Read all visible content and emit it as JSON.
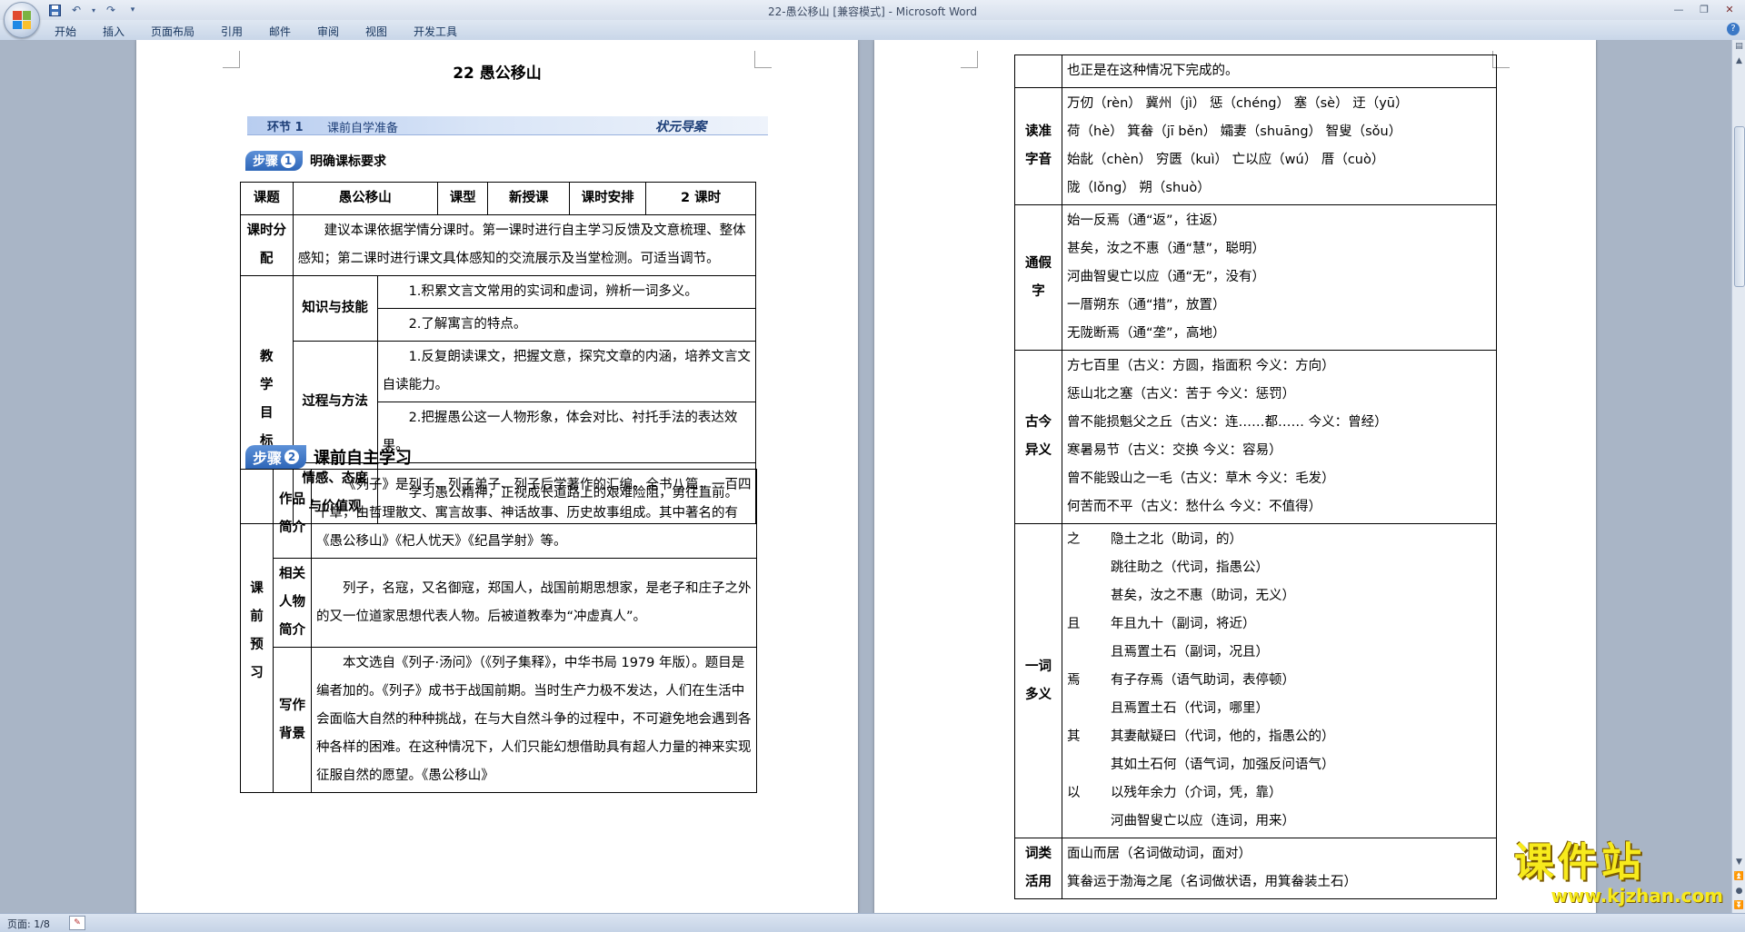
{
  "window": {
    "title": "22-愚公移山 [兼容模式] - Microsoft Word",
    "controls": [
      "minimize-icon",
      "restore-icon",
      "close-icon"
    ]
  },
  "ribbon": {
    "tabs": [
      "开始",
      "插入",
      "页面布局",
      "引用",
      "邮件",
      "审阅",
      "视图",
      "开发工具"
    ]
  },
  "status": {
    "page": "页面: 1/8"
  },
  "watermark": {
    "main": "课件站",
    "url": "www.kjzhan.com"
  },
  "page1": {
    "title": "22  愚公移山",
    "banner": {
      "tag": "环节 1",
      "mid": "课前自学准备",
      "right": "状元导案"
    },
    "step1": {
      "num": "1",
      "label": "步骤",
      "text": "明确课标要求"
    },
    "table1": {
      "h_title": "课题",
      "v_title": "愚公移山",
      "h_type": "课型",
      "v_type": "新授课",
      "h_arr": "课时安排",
      "v_arr": "2 课时",
      "h_alloc": "课时分配",
      "alloc": "建议本课依据学情分课时。第一课时进行自主学习反馈及文意梳理、整体感知；第二课时进行课文具体感知的交流展示及当堂检测。可适当调节。",
      "h_goal": "教学目标",
      "k1": "知识与技能",
      "k1a": "1.积累文言文常用的实词和虚词，辨析一词多义。",
      "k1b": "2.了解寓言的特点。",
      "k2": "过程与方法",
      "k2a": "1.反复朗读课文，把握文意，探究文章的内涵，培养文言文自读能力。",
      "k2b": "2.把握愚公这一人物形象，体会对比、衬托手法的表达效果。",
      "k3": "情感、态度与价值观",
      "k3a": "学习愚公精神，正视成长道路上的艰难险阻，勇往直前。"
    },
    "step2": {
      "num": "2",
      "label": "步骤",
      "text": "课前自主学习"
    },
    "table2": {
      "h": "课前预习",
      "r1h": "作品简介",
      "r1": "《列子》是列子、列子弟子、列子后学著作的汇编。全书八篇，一百四十章，由哲理散文、寓言故事、神话故事、历史故事组成。其中著名的有《愚公移山》《杞人忧天》《纪昌学射》等。",
      "r2h": "相关人物简介",
      "r2": "列子，名寇，又名御寇，郑国人，战国前期思想家，是老子和庄子之外的又一位道家思想代表人物。后被道教奉为“冲虚真人”。",
      "r3h": "写作背景",
      "r3": "本文选自《列子·汤问》（《列子集释》，中华书局 1979 年版）。题目是编者加的。《列子》成书于战国前期。当时生产力极不发达，人们在生活中会面临大自然的种种挑战，在与大自然斗争的过程中，不可避免地会遇到各种各样的困难。在这种情况下，人们只能幻想借助具有超人力量的神来实现征服自然的愿望。《愚公移山》"
    }
  },
  "page2": {
    "cont": "也正是在这种情况下完成的。",
    "du": {
      "h": "读准字音",
      "lines": [
        "万仞（rèn）    冀州（jì）    惩（chéng）    塞（sè）    迂（yū）",
        "荷（hè）    箕畚（jī běn）    孀妻（shuāng）    智叟（sǒu）",
        "始龀（chèn）    穷匮（kuì）    亡以应（wú）    厝（cuò）",
        "陇（lǒng）    朔（shuò）"
      ]
    },
    "tj": {
      "h": "通假字",
      "lines": [
        "始一反焉（通“返”，往返）",
        "甚矣，汝之不惠（通“慧”，聪明）",
        "河曲智叟亡以应（通“无”，没有）",
        "一厝朔东（通“措”，放置）",
        "无陇断焉（通“垄”，高地）"
      ]
    },
    "gj": {
      "h": "古今异义",
      "lines": [
        "方七百里（古义：方圆，指面积      今义：方向）",
        "惩山北之塞（古义：苦于      今义：惩罚）",
        "曾不能损魁父之丘（古义：连……都……      今义：曾经）",
        "寒暑易节（古义：交换      今义：容易）",
        "曾不能毁山之一毛（古义：草木      今义：毛发）",
        "何苦而不平（古义：愁什么      今义：不值得）"
      ]
    },
    "yc": {
      "h": "一词多义",
      "rows": [
        {
          "w": "之",
          "t": "隐土之北（助词，的）"
        },
        {
          "w": "",
          "t": "跳往助之（代词，指愚公）"
        },
        {
          "w": "",
          "t": "甚矣，汝之不惠（助词，无义）"
        },
        {
          "w": "且",
          "t": "年且九十（副词，将近）"
        },
        {
          "w": "",
          "t": "且焉置土石（副词，况且）"
        },
        {
          "w": "焉",
          "t": "有子存焉（语气助词，表停顿）"
        },
        {
          "w": "",
          "t": "且焉置土石（代词，哪里）"
        },
        {
          "w": "其",
          "t": "其妻献疑曰（代词，他的，指愚公的）"
        },
        {
          "w": "",
          "t": "其如土石何（语气词，加强反问语气）"
        },
        {
          "w": "以",
          "t": "以残年余力（介词，凭，靠）"
        },
        {
          "w": "",
          "t": "河曲智叟亡以应（连词，用来）"
        }
      ]
    },
    "cl": {
      "h": "词类活用",
      "lines": [
        "面山而居（名词做动词，面对）",
        "箕畚运于渤海之尾（名词做状语，用箕畚装土石）"
      ]
    }
  }
}
